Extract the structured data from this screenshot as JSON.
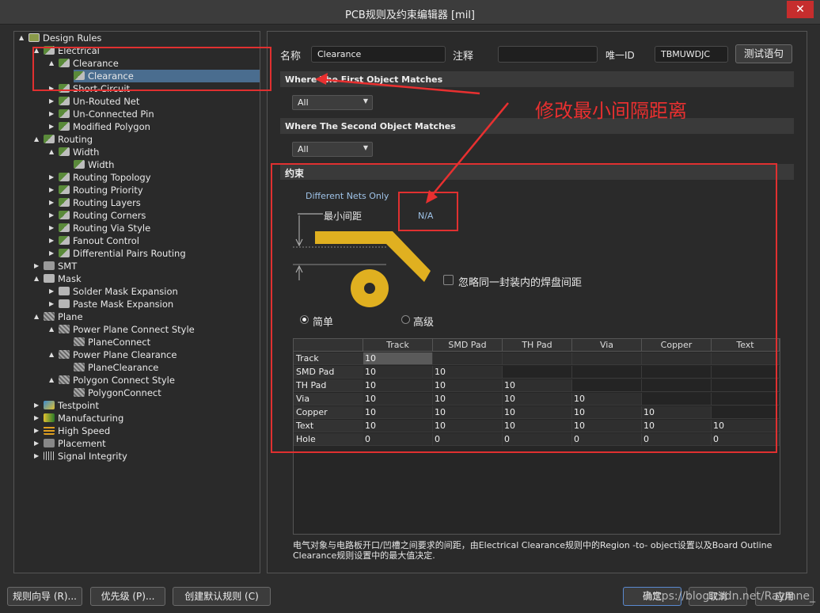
{
  "window": {
    "title": "PCB规则及约束编辑器 [mil]",
    "close_glyph": "✕"
  },
  "tree": {
    "items": [
      {
        "label": "Design Rules",
        "icon": "design-rules-icon"
      },
      {
        "label": "Electrical",
        "icon": "electrical-icon"
      },
      {
        "label": "Clearance",
        "icon": "rule-icon"
      },
      {
        "label": "Clearance",
        "icon": "rule-icon"
      },
      {
        "label": "Short-Circuit",
        "icon": "rule-icon"
      },
      {
        "label": "Un-Routed Net",
        "icon": "rule-icon"
      },
      {
        "label": "Un-Connected Pin",
        "icon": "rule-icon"
      },
      {
        "label": "Modified Polygon",
        "icon": "rule-icon"
      },
      {
        "label": "Routing",
        "icon": "routing-icon"
      },
      {
        "label": "Width",
        "icon": "rule-icon"
      },
      {
        "label": "Width",
        "icon": "rule-icon"
      },
      {
        "label": "Routing Topology",
        "icon": "rule-icon"
      },
      {
        "label": "Routing Priority",
        "icon": "rule-icon"
      },
      {
        "label": "Routing Layers",
        "icon": "rule-icon"
      },
      {
        "label": "Routing Corners",
        "icon": "rule-icon"
      },
      {
        "label": "Routing Via Style",
        "icon": "rule-icon"
      },
      {
        "label": "Fanout Control",
        "icon": "rule-icon"
      },
      {
        "label": "Differential Pairs Routing",
        "icon": "rule-icon"
      },
      {
        "label": "SMT",
        "icon": "smt-icon"
      },
      {
        "label": "Mask",
        "icon": "mask-icon"
      },
      {
        "label": "Solder Mask Expansion",
        "icon": "mask-icon"
      },
      {
        "label": "Paste Mask Expansion",
        "icon": "mask-icon"
      },
      {
        "label": "Plane",
        "icon": "plane-icon"
      },
      {
        "label": "Power Plane Connect Style",
        "icon": "plane-icon"
      },
      {
        "label": "PlaneConnect",
        "icon": "plane-icon"
      },
      {
        "label": "Power Plane Clearance",
        "icon": "plane-icon"
      },
      {
        "label": "PlaneClearance",
        "icon": "plane-icon"
      },
      {
        "label": "Polygon Connect Style",
        "icon": "plane-icon"
      },
      {
        "label": "PolygonConnect",
        "icon": "plane-icon"
      },
      {
        "label": "Testpoint",
        "icon": "testpoint-icon"
      },
      {
        "label": "Manufacturing",
        "icon": "manufacturing-icon"
      },
      {
        "label": "High Speed",
        "icon": "high-speed-icon"
      },
      {
        "label": "Placement",
        "icon": "placement-icon"
      },
      {
        "label": "Signal Integrity",
        "icon": "signal-integrity-icon"
      }
    ]
  },
  "rule": {
    "name_label": "名称",
    "name_value": "Clearance",
    "comment_label": "注释",
    "comment_value": "",
    "id_label": "唯一ID",
    "id_value": "TBMUWDJC",
    "test_button": "测试语句"
  },
  "first_match": {
    "title": "Where The First Object Matches",
    "value": "All"
  },
  "second_match": {
    "title": "Where The Second Object Matches",
    "value": "All"
  },
  "constraints": {
    "title": "约束",
    "diff_nets": "Different Nets Only",
    "min_clearance_label": "最小间距",
    "min_clearance_value": "N/A",
    "ignore_checkbox": "忽略同一封装内的焊盘间距",
    "simple_label": "简单",
    "advanced_label": "高级",
    "mode": "simple"
  },
  "annotation": {
    "text": "修改最小间隔距离"
  },
  "grid": {
    "columns": [
      "Track",
      "SMD Pad",
      "TH Pad",
      "Via",
      "Copper",
      "Text"
    ],
    "rows": [
      {
        "name": "Track",
        "values": [
          "10"
        ]
      },
      {
        "name": "SMD Pad",
        "values": [
          "10",
          "10"
        ]
      },
      {
        "name": "TH Pad",
        "values": [
          "10",
          "10",
          "10"
        ]
      },
      {
        "name": "Via",
        "values": [
          "10",
          "10",
          "10",
          "10"
        ]
      },
      {
        "name": "Copper",
        "values": [
          "10",
          "10",
          "10",
          "10",
          "10"
        ]
      },
      {
        "name": "Text",
        "values": [
          "10",
          "10",
          "10",
          "10",
          "10",
          "10"
        ]
      },
      {
        "name": "Hole",
        "values": [
          "0",
          "0",
          "0",
          "0",
          "0",
          "0"
        ]
      }
    ]
  },
  "description": "电气对象与电路板开口/凹槽之间要求的间距，由Electrical Clearance规则中的Region -to- object设置以及Board Outline Clearance规则设置中的最大值决定.",
  "footer": {
    "wizard": "规则向导 (R)...",
    "priority": "优先级 (P)...",
    "create_default": "创建默认规则 (C)",
    "ok": "确定",
    "cancel": "取消",
    "apply": "应用"
  },
  "watermark": "https://blog.csdn.net/Raymne_"
}
